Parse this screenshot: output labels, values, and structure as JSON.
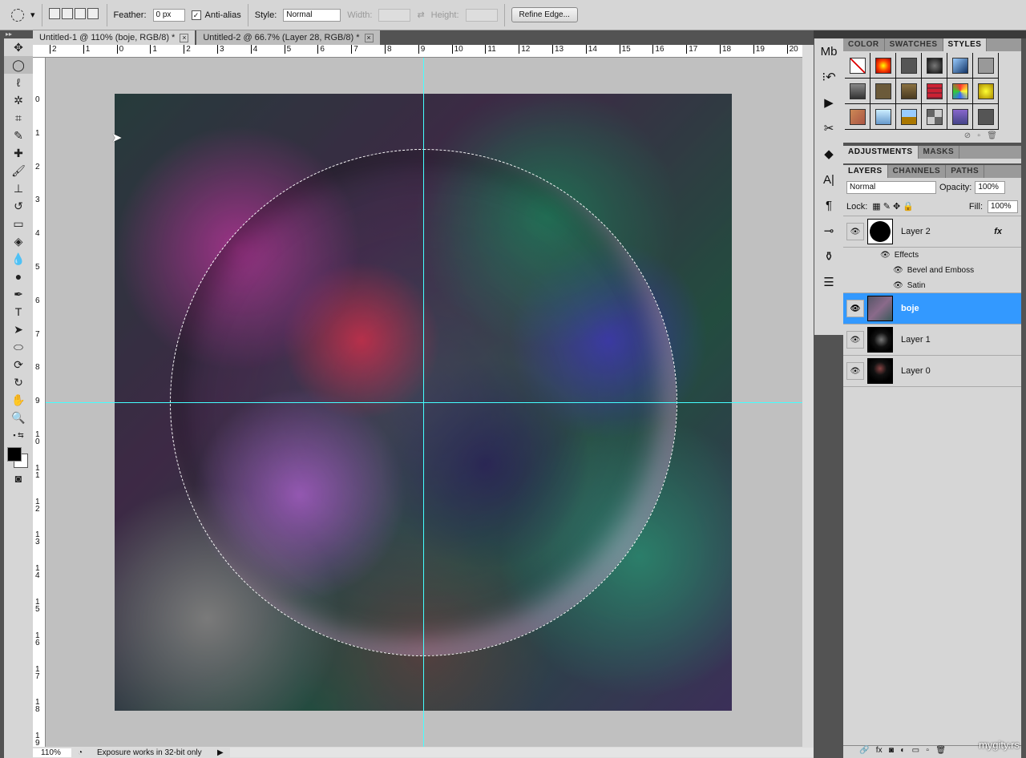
{
  "options": {
    "feather_label": "Feather:",
    "feather_value": "0 px",
    "antialias_label": "Anti-alias",
    "antialias_checked": true,
    "style_label": "Style:",
    "style_value": "Normal",
    "width_label": "Width:",
    "height_label": "Height:",
    "refine_edge": "Refine Edge..."
  },
  "tabs": [
    {
      "label": "Untitled-1 @ 110% (boje, RGB/8) *",
      "active": true
    },
    {
      "label": "Untitled-2 @ 66.7% (Layer 28, RGB/8) *",
      "active": false
    }
  ],
  "ruler_top": [
    "2",
    "1",
    "0",
    "1",
    "2",
    "3",
    "4",
    "5",
    "6",
    "7",
    "8",
    "9",
    "10",
    "11",
    "12",
    "13",
    "14",
    "15",
    "16",
    "17",
    "18",
    "19",
    "20"
  ],
  "ruler_left": [
    "0",
    "1",
    "2",
    "3",
    "4",
    "5",
    "6",
    "7",
    "8",
    "9",
    "10",
    "11",
    "12",
    "13",
    "14",
    "15",
    "16",
    "17",
    "18",
    "19"
  ],
  "status": {
    "zoom": "110%",
    "info": "Exposure works in 32-bit only"
  },
  "styles_panel": {
    "tabs": [
      "COLOR",
      "SWATCHES",
      "STYLES"
    ],
    "active": "STYLES"
  },
  "adjust_panel": {
    "tabs": [
      "ADJUSTMENTS",
      "MASKS"
    ]
  },
  "layers_panel": {
    "tabs": [
      "LAYERS",
      "CHANNELS",
      "PATHS"
    ],
    "blend_mode": "Normal",
    "opacity_label": "Opacity:",
    "opacity": "100%",
    "lock_label": "Lock:",
    "fill_label": "Fill:",
    "fill": "100%",
    "layers": [
      {
        "name": "Layer 2",
        "fx": "fx",
        "effects_label": "Effects",
        "effects": [
          "Bevel and Emboss",
          "Satin"
        ]
      },
      {
        "name": "boje",
        "selected": true
      },
      {
        "name": "Layer 1"
      },
      {
        "name": "Layer 0"
      }
    ]
  },
  "watermark": "mygity.rs",
  "colors": {
    "selection": "#3399ff",
    "guide": "#44ffff"
  }
}
